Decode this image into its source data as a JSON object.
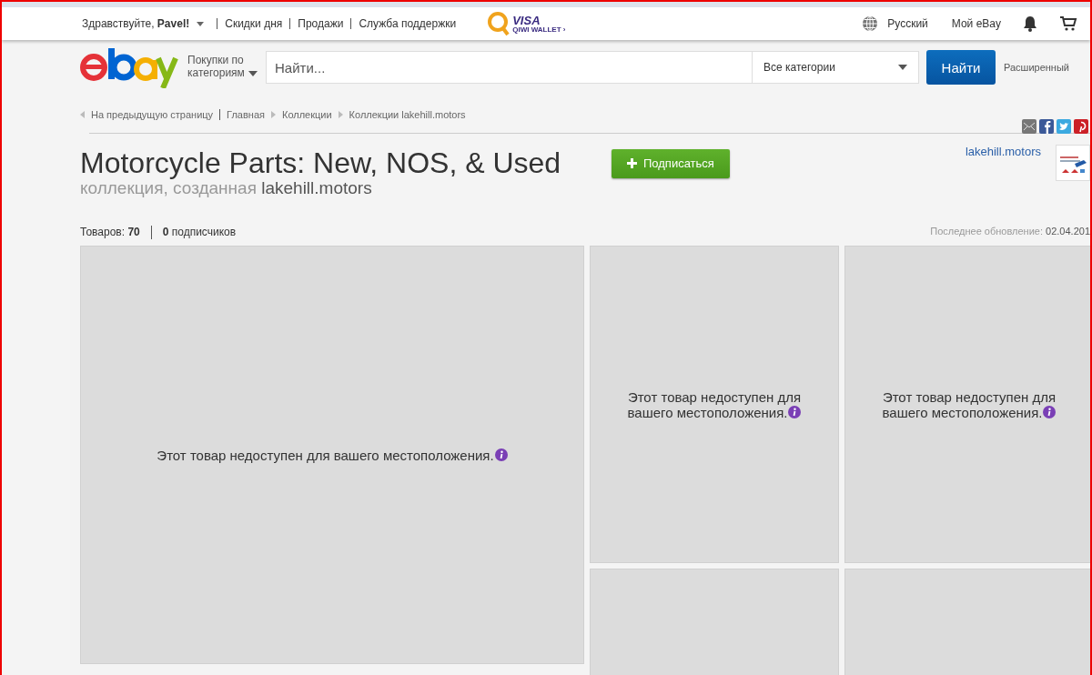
{
  "top_bar": {
    "greeting": "Здравствуйте, **Pavel!**",
    "links": [
      "Скидки дня",
      "Продажи",
      "Служба поддержки"
    ],
    "promo": {
      "line_1": "VISA",
      "line_2": "QIWI WALLET ›"
    },
    "language": "Русский",
    "my_ebay": "Мой eBay"
  },
  "header": {
    "category_menu": "Покупки по категориям",
    "search": {
      "placeholder": "Найти..."
    },
    "category_select": "Все категории",
    "search_button": "Найти",
    "advanced": "Расширенный"
  },
  "breadcrumbs": {
    "back": "На предыдущую страницу",
    "items": [
      "Главная",
      "Коллекции",
      "Коллекции lakehill.motors"
    ]
  },
  "collection": {
    "title": "Motorcycle Parts: New, NOS, & Used",
    "follow_button": "Подписаться",
    "subtitle": "коллекция, созданная",
    "owner": "lakehill.motors",
    "seller_link": "lakehill.motors",
    "items_label": "Товаров:",
    "items_count": "70",
    "followers_count": "0",
    "followers_label": "подписчиков",
    "updated_label": "Последнее обновление:",
    "updated_date": "02.04.201"
  },
  "tiles": [
    {
      "kind": "large",
      "message": "Этот товар недоступен для вашего местоположения."
    },
    {
      "kind": "small",
      "message": "Этот товар недоступен для вашего местоположения."
    },
    {
      "kind": "small",
      "message": "Этот товар недоступен для вашего местоположения."
    },
    {
      "kind": "small"
    },
    {
      "kind": "small"
    }
  ]
}
